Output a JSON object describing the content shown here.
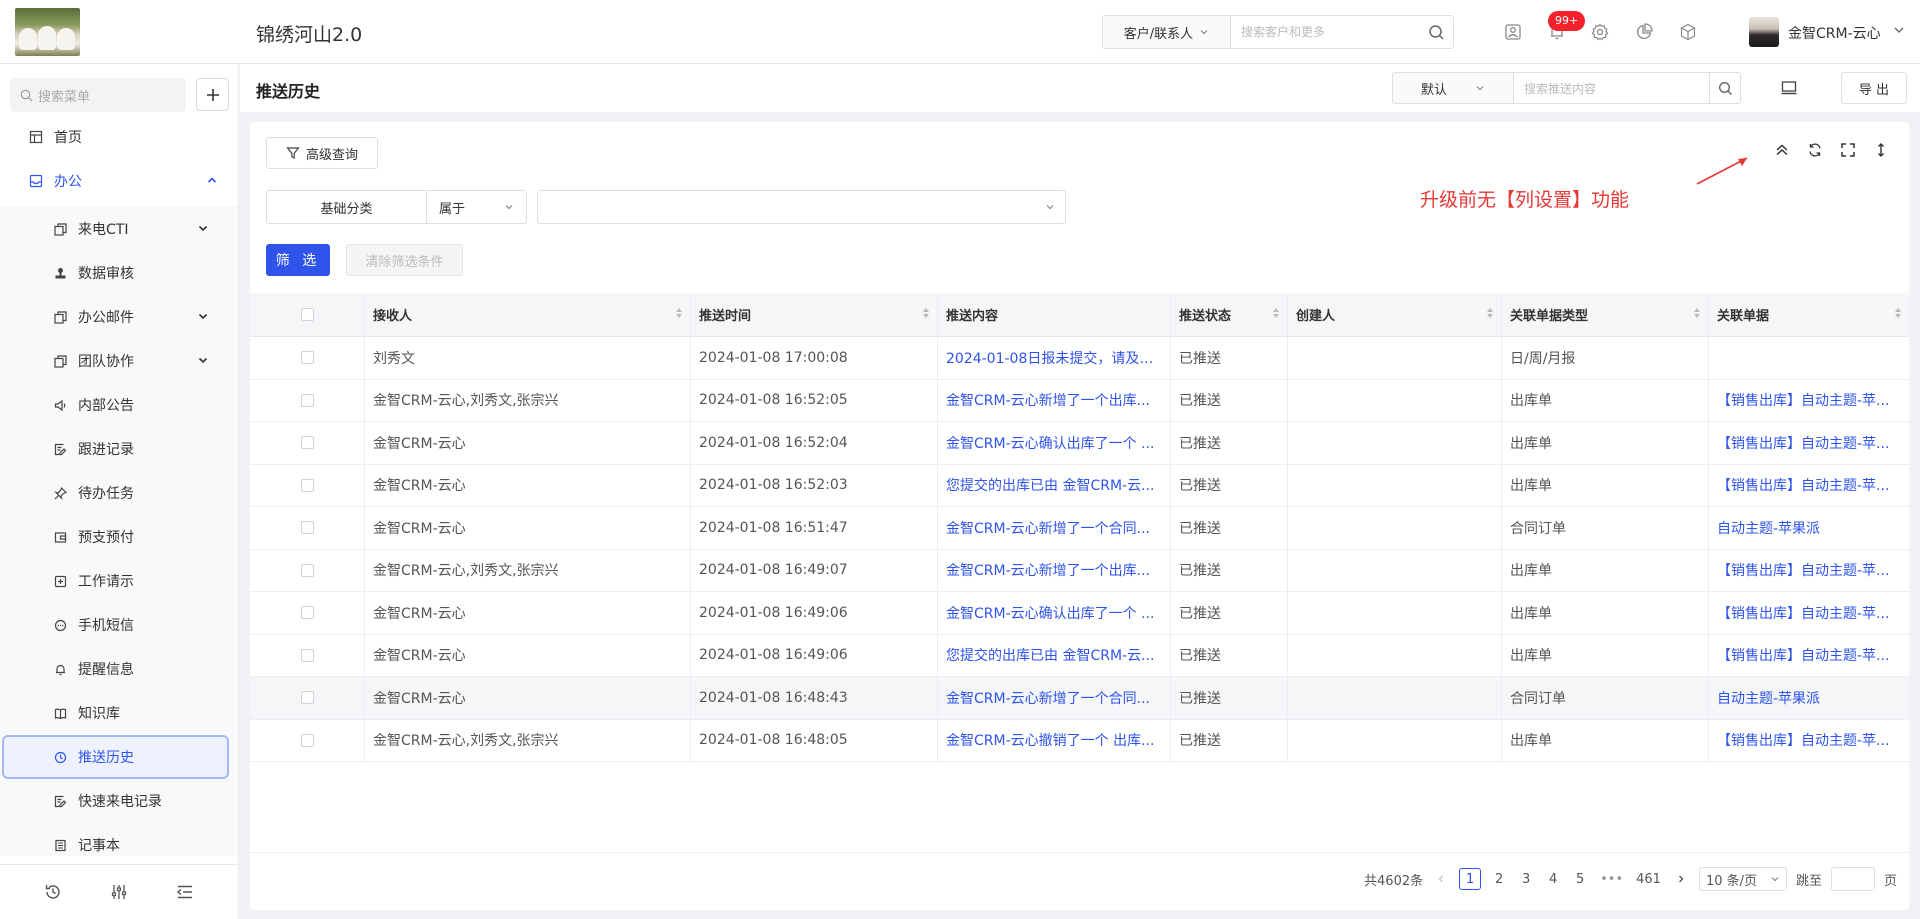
{
  "header": {
    "app_title": "锦绣河山2.0",
    "search_scope": "客户/联系人",
    "search_placeholder": "搜索客户和更多",
    "notification_badge": "99+",
    "user_name": "金智CRM-云心"
  },
  "sidebar": {
    "search_placeholder": "搜索菜单",
    "items": [
      {
        "label": "首页",
        "icon": "layout-icon"
      },
      {
        "label": "办公",
        "icon": "inbox-icon",
        "expanded": true
      },
      {
        "label": "来电CTI",
        "icon": "copy-icon",
        "has_children": true
      },
      {
        "label": "数据审核",
        "icon": "stamp-icon"
      },
      {
        "label": "办公邮件",
        "icon": "copy-icon",
        "has_children": true
      },
      {
        "label": "团队协作",
        "icon": "copy-icon",
        "has_children": true
      },
      {
        "label": "内部公告",
        "icon": "megaphone-icon"
      },
      {
        "label": "跟进记录",
        "icon": "edit-doc-icon"
      },
      {
        "label": "待办任务",
        "icon": "pin-icon"
      },
      {
        "label": "预支预付",
        "icon": "wallet-icon"
      },
      {
        "label": "工作请示",
        "icon": "plus-square-icon"
      },
      {
        "label": "手机短信",
        "icon": "chat-icon"
      },
      {
        "label": "提醒信息",
        "icon": "bell-icon"
      },
      {
        "label": "知识库",
        "icon": "book-icon"
      },
      {
        "label": "推送历史",
        "icon": "clock-icon",
        "active": true
      },
      {
        "label": "快速来电记录",
        "icon": "edit-doc-icon"
      },
      {
        "label": "记事本",
        "icon": "notebook-icon"
      }
    ]
  },
  "page": {
    "title": "推送历史",
    "view_select": "默认",
    "search_placeholder": "搜索推送内容",
    "export_label": "导 出"
  },
  "filters": {
    "advanced_label": "高级查询",
    "field": "基础分类",
    "operator": "属于",
    "value": "",
    "filter_button": "筛 选",
    "clear_button": "清除筛选条件"
  },
  "annotation": "升级前无【列设置】功能",
  "table": {
    "columns": [
      "接收人",
      "推送时间",
      "推送内容",
      "推送状态",
      "创建人",
      "关联单据类型",
      "关联单据"
    ],
    "rows": [
      [
        "刘秀文",
        "2024-01-08 17:00:08",
        "2024-01-08日报未提交，请及时...",
        "已推送",
        "",
        "日/周/月报",
        ""
      ],
      [
        "金智CRM-云心,刘秀文,张宗兴",
        "2024-01-08 16:52:05",
        "金智CRM-云心新增了一个出库...",
        "已推送",
        "",
        "出库单",
        "【销售出库】自动主题-苹..."
      ],
      [
        "金智CRM-云心",
        "2024-01-08 16:52:04",
        "金智CRM-云心确认出库了一个 ...",
        "已推送",
        "",
        "出库单",
        "【销售出库】自动主题-苹..."
      ],
      [
        "金智CRM-云心",
        "2024-01-08 16:52:03",
        "您提交的出库已由 金智CRM-云...",
        "已推送",
        "",
        "出库单",
        "【销售出库】自动主题-苹..."
      ],
      [
        "金智CRM-云心",
        "2024-01-08 16:51:47",
        "金智CRM-云心新增了一个合同...",
        "已推送",
        "",
        "合同订单",
        "自动主题-苹果派"
      ],
      [
        "金智CRM-云心,刘秀文,张宗兴",
        "2024-01-08 16:49:07",
        "金智CRM-云心新增了一个出库...",
        "已推送",
        "",
        "出库单",
        "【销售出库】自动主题-苹..."
      ],
      [
        "金智CRM-云心",
        "2024-01-08 16:49:06",
        "金智CRM-云心确认出库了一个 ...",
        "已推送",
        "",
        "出库单",
        "【销售出库】自动主题-苹..."
      ],
      [
        "金智CRM-云心",
        "2024-01-08 16:49:06",
        "您提交的出库已由 金智CRM-云...",
        "已推送",
        "",
        "出库单",
        "【销售出库】自动主题-苹..."
      ],
      [
        "金智CRM-云心",
        "2024-01-08 16:48:43",
        "金智CRM-云心新增了一个合同...",
        "已推送",
        "",
        "合同订单",
        "自动主题-苹果派"
      ],
      [
        "金智CRM-云心,刘秀文,张宗兴",
        "2024-01-08 16:48:05",
        "金智CRM-云心撤销了一个 出库...",
        "已推送",
        "",
        "出库单",
        "【销售出库】自动主题-苹..."
      ]
    ]
  },
  "pagination": {
    "total": "共4602条",
    "pages": [
      "1",
      "2",
      "3",
      "4",
      "5",
      "•••",
      "461"
    ],
    "current": "1",
    "page_size": "10 条/页",
    "jump_label": "跳至",
    "page_suffix": "页"
  },
  "colors": {
    "primary": "#2f54eb",
    "badge": "#f5222d",
    "annotation": "#e53935"
  }
}
